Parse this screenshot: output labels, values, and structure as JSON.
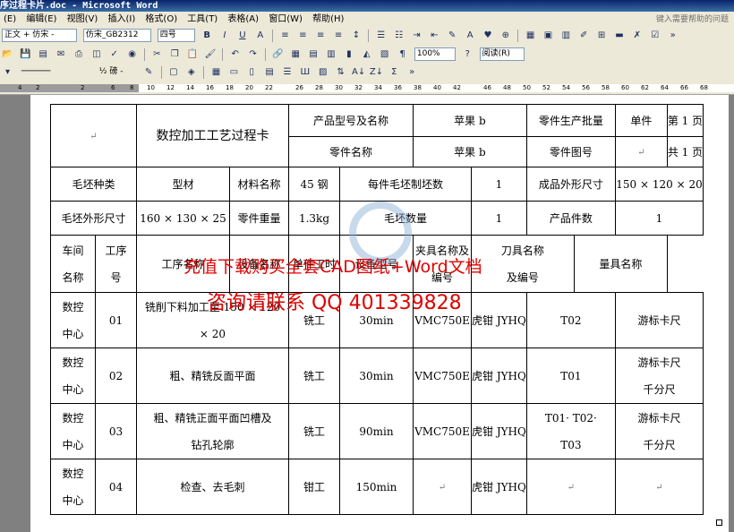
{
  "window": {
    "title": "序过程卡片.doc - Microsoft Word"
  },
  "menu": {
    "items": [
      "(E)",
      "编辑(E)",
      "视图(V)",
      "插入(I)",
      "格式(O)",
      "工具(T)",
      "表格(A)",
      "窗口(W)",
      "帮助(H)"
    ],
    "help_placeholder": "键入需要帮助的问题"
  },
  "toolbar_format": {
    "style": "正文 + 仿宋 -",
    "font": "仿宋_GB2312",
    "size": "四号",
    "bold": "B",
    "italic": "I",
    "underline": "U",
    "font_color": "A"
  },
  "toolbar_standard": {
    "zoom": "100%",
    "read_label": "阅读(R)"
  },
  "toolbar_drawing": {
    "line_style": "½ 磅 -"
  },
  "ruler": {
    "numbers": [
      "4",
      "2",
      "2",
      "6",
      "8",
      "10",
      "12",
      "14",
      "16",
      "18",
      "20",
      "22",
      "26",
      "28",
      "30",
      "32",
      "34",
      "36",
      "38",
      "40",
      "42",
      "46",
      "48",
      "50",
      "52",
      "54",
      "56",
      "58",
      "60",
      "62",
      "64",
      "66",
      "68"
    ]
  },
  "card": {
    "title": "数控加工工艺过程卡",
    "product_model_label": "产品型号及名称",
    "product_model": "苹果 b",
    "batch_label": "零件生产批量",
    "batch_unit": "单件",
    "page_label": "第 1 页",
    "part_name_label": "零件名称",
    "part_name": "苹果 b",
    "part_no_label": "零件图号",
    "total_pages": "共 1 页",
    "blank_type_label": "毛坯种类",
    "blank_type": "型材",
    "material_label": "材料名称",
    "material": "45 钢",
    "per_blank_label": "每件毛坯制坯数",
    "per_blank": "1",
    "finished_size_label": "成品外形尺寸",
    "finished_size": "150 × 120 × 20",
    "blank_size_label": "毛坯外形尺寸",
    "blank_size": "160 × 130 × 25",
    "part_weight_label": "零件重量",
    "part_weight": "1.3kg",
    "blank_qty_label": "毛坯数量",
    "blank_qty": "1",
    "product_qty_label": "产品件数",
    "product_qty": "1",
    "headers": {
      "workshop": [
        "车间",
        "名称"
      ],
      "op_no": [
        "工序",
        "号"
      ],
      "op_name": "工序名称",
      "equip_name": "设备名称",
      "work_hours": "单件工时",
      "equip_model": "设备型号",
      "fixture": [
        "夹具名称及",
        "编号"
      ],
      "tool": [
        "刀具名称",
        "及编号"
      ],
      "gauge": "量具名称"
    },
    "rows": [
      {
        "workshop": [
          "数控",
          "中心"
        ],
        "no": "01",
        "name": [
          "铣削下料加工至 150 × 120",
          "× 20"
        ],
        "equip": "铣工",
        "hours": "30min",
        "model": "VMC750E",
        "fixture": "虎钳 JYHQ",
        "tool": [
          "T02"
        ],
        "gauge": [
          "游标卡尺"
        ]
      },
      {
        "workshop": [
          "数控",
          "中心"
        ],
        "no": "02",
        "name": [
          "粗、精铣反面平面"
        ],
        "equip": "铣工",
        "hours": "30min",
        "model": "VMC750E",
        "fixture": "虎钳 JYHQ",
        "tool": [
          "T01"
        ],
        "gauge": [
          "游标卡尺",
          "千分尺"
        ]
      },
      {
        "workshop": [
          "数控",
          "中心"
        ],
        "no": "03",
        "name": [
          "粗、精铣正面平面凹槽及",
          "钻孔轮廓"
        ],
        "equip": "铣工",
        "hours": "90min",
        "model": "VMC750E",
        "fixture": "虎钳 JYHQ",
        "tool": [
          "T01· T02·",
          "T03"
        ],
        "gauge": [
          "游标卡尺",
          "千分尺"
        ]
      },
      {
        "workshop": [
          "数控",
          "中心"
        ],
        "no": "04",
        "name": [
          "检查、去毛刺"
        ],
        "equip": "钳工",
        "hours": "150min",
        "model": "",
        "fixture": "虎钳 JYHQ",
        "tool": [
          ""
        ],
        "gauge": [
          ""
        ]
      }
    ]
  },
  "watermark": {
    "line1": "充值下载购买全套CAD图纸+Word文档",
    "line2": "咨询请联系 QQ 401339828"
  },
  "colors": {
    "watermark": "#e00000",
    "title_bar": "#0a246a",
    "chrome": "#ece9d8"
  }
}
